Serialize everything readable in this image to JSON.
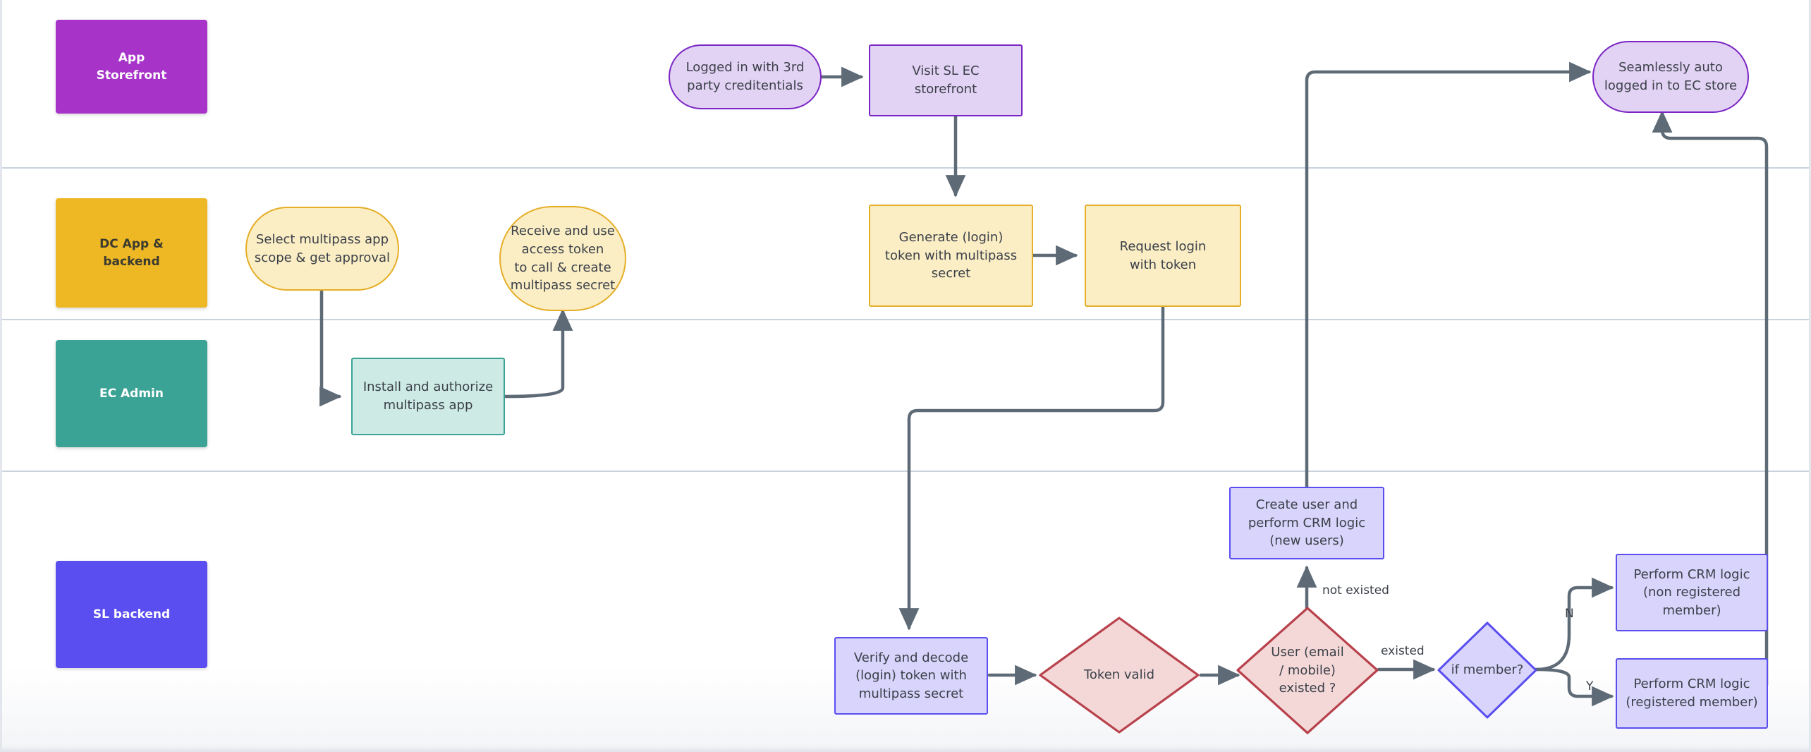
{
  "diagram": {
    "title": "Multipass SSO swimlane flow",
    "colors": {
      "connector": "#5e6b77",
      "lane_divider": "#c9d2dd",
      "canvas": "#ffffff",
      "lane_storefront": "#a733c9",
      "lane_dc": "#eeb724",
      "lane_ec": "#3ba396",
      "lane_sl": "#5a4ef0",
      "purple_fill": "#e2d2f4",
      "purple_stroke": "#7a25c4",
      "yellow_fill": "#fbeec5",
      "yellow_stroke": "#e5ae27",
      "teal_fill": "#cdeae4",
      "teal_stroke": "#3ba396",
      "indigo_fill": "#d8d4fb",
      "indigo_stroke": "#5a4ef0",
      "red_fill": "#f4d8d8",
      "red_stroke": "#b8424c"
    },
    "lanes": [
      {
        "id": "storefront",
        "label": "App\nStorefront"
      },
      {
        "id": "dc",
        "label": "DC App &\nbackend"
      },
      {
        "id": "ec",
        "label": "EC Admin"
      },
      {
        "id": "sl",
        "label": "SL backend"
      }
    ],
    "nodes": [
      {
        "id": "logged-in",
        "label": "Logged in with 3rd\nparty creditentials"
      },
      {
        "id": "visit-storefront",
        "label": "Visit SL EC\nstorefront"
      },
      {
        "id": "seamless-login",
        "label": "Seamlessly auto\nlogged in to EC store"
      },
      {
        "id": "select-scope",
        "label": "Select multipass app\nscope & get approval"
      },
      {
        "id": "receive-token",
        "label": "Receive and use\naccess token\nto call & create\nmultipass secret"
      },
      {
        "id": "generate-token",
        "label": "Generate (login)\ntoken with multipass\nsecret"
      },
      {
        "id": "request-login",
        "label": "Request login\nwith token"
      },
      {
        "id": "install-app",
        "label": "Install and authorize\nmultipass app"
      },
      {
        "id": "create-user",
        "label": "Create user and\nperform CRM logic\n(new users)"
      },
      {
        "id": "crm-non-member",
        "label": "Perform CRM logic\n(non registered\nmember)"
      },
      {
        "id": "crm-member",
        "label": "Perform CRM logic\n(registered member)"
      },
      {
        "id": "verify-token",
        "label": "Verify and decode\n(login) token with\nmultipass secret"
      },
      {
        "id": "token-valid",
        "label": "Token valid"
      },
      {
        "id": "user-existed",
        "label": "User (email\n/ mobile)\nexisted ?"
      },
      {
        "id": "if-member",
        "label": "if member?"
      }
    ],
    "edge_labels": [
      {
        "id": "not-existed",
        "label": "not existed"
      },
      {
        "id": "existed",
        "label": "existed"
      },
      {
        "id": "branch-n",
        "label": "N"
      },
      {
        "id": "branch-y",
        "label": "Y"
      }
    ]
  }
}
